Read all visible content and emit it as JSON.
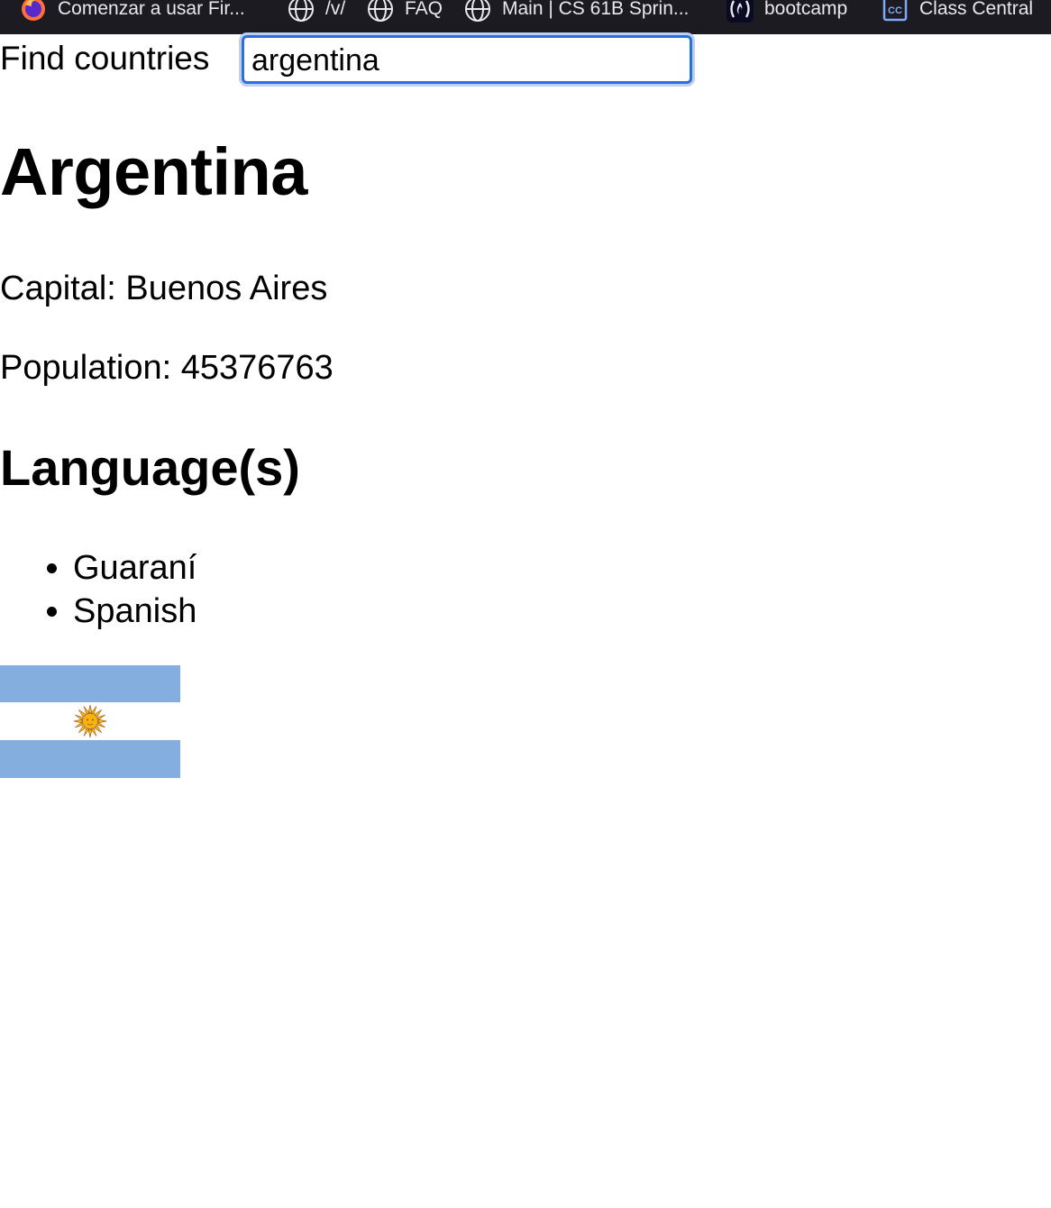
{
  "bookmarks": [
    {
      "label": "Comenzar a usar Fir...",
      "icon": "firefox-icon"
    },
    {
      "label": "/v/",
      "icon": "globe-icon"
    },
    {
      "label": "FAQ",
      "icon": "globe-icon"
    },
    {
      "label": "Main | CS 61B Sprin...",
      "icon": "globe-icon"
    },
    {
      "label": "bootcamp",
      "icon": "freecodecamp-icon"
    },
    {
      "label": "Class Central",
      "icon": "class-central-icon"
    }
  ],
  "search": {
    "label": "Find countries",
    "value": "argentina"
  },
  "country": {
    "name": "Argentina",
    "capital_label": "Capital:",
    "capital": "Buenos Aires",
    "population_label": "Population:",
    "population": "45376763",
    "languages_heading": "Language(s)",
    "languages": [
      "Guaraní",
      "Spanish"
    ],
    "flag": {
      "name": "argentina-flag",
      "colors": {
        "celeste": "#84aedd",
        "white": "#ffffff",
        "sun": "#f6b40e",
        "sun_stroke": "#85340a"
      }
    }
  },
  "colors": {
    "bookmarks_bar_bg": "#1c1b22",
    "bookmarks_text": "#e8e8ee",
    "input_focus_border": "#2f6fdc"
  }
}
